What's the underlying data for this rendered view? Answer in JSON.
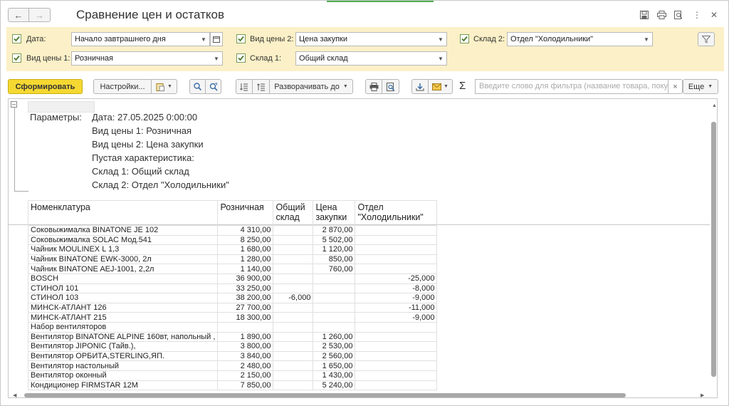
{
  "header": {
    "title": "Сравнение цен и остатков",
    "back_icon": "arrow-left-icon",
    "forward_icon": "arrow-right-icon"
  },
  "filters": {
    "date": {
      "label": "Дата:",
      "value": "Начало завтрашнего дня",
      "checked": true
    },
    "price_type_1": {
      "label": "Вид цены 1:",
      "value": "Розничная",
      "checked": true
    },
    "price_type_2": {
      "label": "Вид цены 2:",
      "value": "Цена закупки",
      "checked": true
    },
    "warehouse_1": {
      "label": "Склад 1:",
      "value": "Общий склад",
      "checked": true
    },
    "warehouse_2": {
      "label": "Склад 2:",
      "value": "Отдел \"Холодильники\"",
      "checked": true
    }
  },
  "toolbar": {
    "generate_label": "Сформировать",
    "settings_label": "Настройки...",
    "expand_label": "Разворачивать до",
    "search_placeholder": "Введите слово для фильтра (название товара, поку...",
    "more_label": "Еще",
    "sigma": "Σ"
  },
  "report": {
    "params_label": "Параметры:",
    "params": [
      "Дата: 27.05.2025 0:00:00",
      "Вид цены 1: Розничная",
      "Вид цены 2: Цена закупки",
      "Пустая характеристика:",
      "Склад 1: Общий склад",
      "Склад 2: Отдел \"Холодильники\""
    ],
    "columns": {
      "c0": "Номенклатура",
      "c1": "Розничная",
      "c2a": "Общий",
      "c2b": "склад",
      "c3a": "Цена",
      "c3b": "закупки",
      "c4a": "Отдел",
      "c4b": "\"Холодильники\""
    },
    "rows": [
      [
        "Соковыжималка  BINATONE JE 102",
        "4 310,00",
        "",
        "2 870,00",
        ""
      ],
      [
        "Соковыжималка  SOLAC  Мод.541",
        "8 250,00",
        "",
        "5 502,00",
        ""
      ],
      [
        "Чайник MOULINEX L 1,3",
        "1 680,00",
        "",
        "1 120,00",
        ""
      ],
      [
        "Чайник BINATONE  EWK-3000,  2л",
        "1 280,00",
        "",
        "850,00",
        ""
      ],
      [
        "Чайник BINATONE  AEJ-1001,  2,2л",
        "1 140,00",
        "",
        "760,00",
        ""
      ],
      [
        "BOSCH",
        "36 900,00",
        "",
        "",
        "-25,000"
      ],
      [
        "СТИНОЛ 101",
        "33 250,00",
        "",
        "",
        "-8,000"
      ],
      [
        "СТИНОЛ 103",
        "38 200,00",
        "-6,000",
        "",
        "-9,000"
      ],
      [
        "МИНСК-АТЛАНТ 126",
        "27 700,00",
        "",
        "",
        "-11,000"
      ],
      [
        "МИНСК-АТЛАНТ 215",
        "18 300,00",
        "",
        "",
        "-9,000"
      ],
      [
        "Набор вентиляторов",
        "",
        "",
        "",
        ""
      ],
      [
        "Вентилятор BINATONE ALPINE 160вт, напольный ,",
        "1 890,00",
        "",
        "1 260,00",
        ""
      ],
      [
        "Вентилятор JIPONIC (Тайв.),",
        "3 800,00",
        "",
        "2 530,00",
        ""
      ],
      [
        "Вентилятор ОРБИТА,STERLING,ЯП.",
        "3 840,00",
        "",
        "2 560,00",
        ""
      ],
      [
        "Вентилятор настольный",
        "2 480,00",
        "",
        "1 650,00",
        ""
      ],
      [
        "Вентилятор оконный",
        "2 150,00",
        "",
        "1 430,00",
        ""
      ],
      [
        "Кондиционер FIRMSTAR 12М",
        "7 850,00",
        "",
        "5 240,00",
        ""
      ]
    ]
  }
}
